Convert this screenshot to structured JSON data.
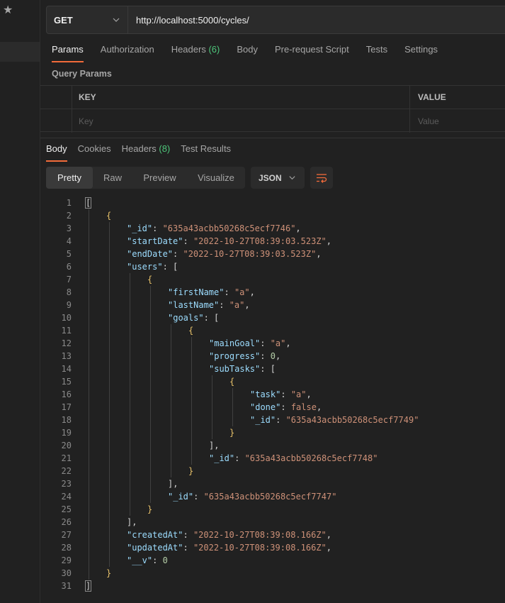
{
  "sidebar": {
    "star_icon": "star-icon"
  },
  "request": {
    "method": "GET",
    "url": "http://localhost:5000/cycles/"
  },
  "request_tabs": [
    {
      "label": "Params",
      "count": "",
      "active": true
    },
    {
      "label": "Authorization",
      "count": "",
      "active": false
    },
    {
      "label": "Headers",
      "count": "(6)",
      "active": false
    },
    {
      "label": "Body",
      "count": "",
      "active": false
    },
    {
      "label": "Pre-request Script",
      "count": "",
      "active": false
    },
    {
      "label": "Tests",
      "count": "",
      "active": false
    },
    {
      "label": "Settings",
      "count": "",
      "active": false
    }
  ],
  "query_params": {
    "title": "Query Params",
    "headers": {
      "key": "KEY",
      "value": "VALUE"
    },
    "placeholders": {
      "key": "Key",
      "value": "Value"
    }
  },
  "response_tabs": [
    {
      "label": "Body",
      "count": "",
      "active": true
    },
    {
      "label": "Cookies",
      "count": "",
      "active": false
    },
    {
      "label": "Headers",
      "count": "(8)",
      "active": false
    },
    {
      "label": "Test Results",
      "count": "",
      "active": false
    }
  ],
  "format_modes": [
    "Pretty",
    "Raw",
    "Preview",
    "Visualize"
  ],
  "active_format": "Pretty",
  "language": "JSON",
  "colors": {
    "accent": "#f26b3a",
    "count_green": "#4ec77b",
    "json_key": "#9cdcfe",
    "json_string": "#ce9178",
    "json_number": "#b5cea8"
  },
  "response_lines": [
    {
      "n": "1",
      "indent": 0,
      "parts": [
        [
          "p",
          "["
        ]
      ]
    },
    {
      "n": "2",
      "indent": 1,
      "parts": [
        [
          "br",
          "{"
        ]
      ]
    },
    {
      "n": "3",
      "indent": 2,
      "parts": [
        [
          "k",
          "\"_id\""
        ],
        [
          "p",
          ": "
        ],
        [
          "s",
          "\"635a43acbb50268c5ecf7746\""
        ],
        [
          "p",
          ","
        ]
      ]
    },
    {
      "n": "4",
      "indent": 2,
      "parts": [
        [
          "k",
          "\"startDate\""
        ],
        [
          "p",
          ": "
        ],
        [
          "s",
          "\"2022-10-27T08:39:03.523Z\""
        ],
        [
          "p",
          ","
        ]
      ]
    },
    {
      "n": "5",
      "indent": 2,
      "parts": [
        [
          "k",
          "\"endDate\""
        ],
        [
          "p",
          ": "
        ],
        [
          "s",
          "\"2022-10-27T08:39:03.523Z\""
        ],
        [
          "p",
          ","
        ]
      ]
    },
    {
      "n": "6",
      "indent": 2,
      "parts": [
        [
          "k",
          "\"users\""
        ],
        [
          "p",
          ": ["
        ]
      ]
    },
    {
      "n": "7",
      "indent": 3,
      "parts": [
        [
          "br",
          "{"
        ]
      ]
    },
    {
      "n": "8",
      "indent": 4,
      "parts": [
        [
          "k",
          "\"firstName\""
        ],
        [
          "p",
          ": "
        ],
        [
          "s",
          "\"a\""
        ],
        [
          "p",
          ","
        ]
      ]
    },
    {
      "n": "9",
      "indent": 4,
      "parts": [
        [
          "k",
          "\"lastName\""
        ],
        [
          "p",
          ": "
        ],
        [
          "s",
          "\"a\""
        ],
        [
          "p",
          ","
        ]
      ]
    },
    {
      "n": "10",
      "indent": 4,
      "parts": [
        [
          "k",
          "\"goals\""
        ],
        [
          "p",
          ": ["
        ]
      ]
    },
    {
      "n": "11",
      "indent": 5,
      "parts": [
        [
          "br",
          "{"
        ]
      ]
    },
    {
      "n": "12",
      "indent": 6,
      "parts": [
        [
          "k",
          "\"mainGoal\""
        ],
        [
          "p",
          ": "
        ],
        [
          "s",
          "\"a\""
        ],
        [
          "p",
          ","
        ]
      ]
    },
    {
      "n": "13",
      "indent": 6,
      "parts": [
        [
          "k",
          "\"progress\""
        ],
        [
          "p",
          ": "
        ],
        [
          "n",
          "0"
        ],
        [
          "p",
          ","
        ]
      ]
    },
    {
      "n": "14",
      "indent": 6,
      "parts": [
        [
          "k",
          "\"subTasks\""
        ],
        [
          "p",
          ": ["
        ]
      ]
    },
    {
      "n": "15",
      "indent": 7,
      "parts": [
        [
          "br",
          "{"
        ]
      ]
    },
    {
      "n": "16",
      "indent": 8,
      "parts": [
        [
          "k",
          "\"task\""
        ],
        [
          "p",
          ": "
        ],
        [
          "s",
          "\"a\""
        ],
        [
          "p",
          ","
        ]
      ]
    },
    {
      "n": "17",
      "indent": 8,
      "parts": [
        [
          "k",
          "\"done\""
        ],
        [
          "p",
          ": "
        ],
        [
          "b",
          "false"
        ],
        [
          "p",
          ","
        ]
      ]
    },
    {
      "n": "18",
      "indent": 8,
      "parts": [
        [
          "k",
          "\"_id\""
        ],
        [
          "p",
          ": "
        ],
        [
          "s",
          "\"635a43acbb50268c5ecf7749\""
        ]
      ]
    },
    {
      "n": "19",
      "indent": 7,
      "parts": [
        [
          "br",
          "}"
        ]
      ]
    },
    {
      "n": "20",
      "indent": 6,
      "parts": [
        [
          "p",
          "],"
        ]
      ]
    },
    {
      "n": "21",
      "indent": 6,
      "parts": [
        [
          "k",
          "\"_id\""
        ],
        [
          "p",
          ": "
        ],
        [
          "s",
          "\"635a43acbb50268c5ecf7748\""
        ]
      ]
    },
    {
      "n": "22",
      "indent": 5,
      "parts": [
        [
          "br",
          "}"
        ]
      ]
    },
    {
      "n": "23",
      "indent": 4,
      "parts": [
        [
          "p",
          "],"
        ]
      ]
    },
    {
      "n": "24",
      "indent": 4,
      "parts": [
        [
          "k",
          "\"_id\""
        ],
        [
          "p",
          ": "
        ],
        [
          "s",
          "\"635a43acbb50268c5ecf7747\""
        ]
      ]
    },
    {
      "n": "25",
      "indent": 3,
      "parts": [
        [
          "br",
          "}"
        ]
      ]
    },
    {
      "n": "26",
      "indent": 2,
      "parts": [
        [
          "p",
          "],"
        ]
      ]
    },
    {
      "n": "27",
      "indent": 2,
      "parts": [
        [
          "k",
          "\"createdAt\""
        ],
        [
          "p",
          ": "
        ],
        [
          "s",
          "\"2022-10-27T08:39:08.166Z\""
        ],
        [
          "p",
          ","
        ]
      ]
    },
    {
      "n": "28",
      "indent": 2,
      "parts": [
        [
          "k",
          "\"updatedAt\""
        ],
        [
          "p",
          ": "
        ],
        [
          "s",
          "\"2022-10-27T08:39:08.166Z\""
        ],
        [
          "p",
          ","
        ]
      ]
    },
    {
      "n": "29",
      "indent": 2,
      "parts": [
        [
          "k",
          "\"__v\""
        ],
        [
          "p",
          ": "
        ],
        [
          "n",
          "0"
        ]
      ]
    },
    {
      "n": "30",
      "indent": 1,
      "parts": [
        [
          "br",
          "}"
        ]
      ]
    },
    {
      "n": "31",
      "indent": 0,
      "parts": [
        [
          "p",
          "]"
        ]
      ]
    }
  ]
}
